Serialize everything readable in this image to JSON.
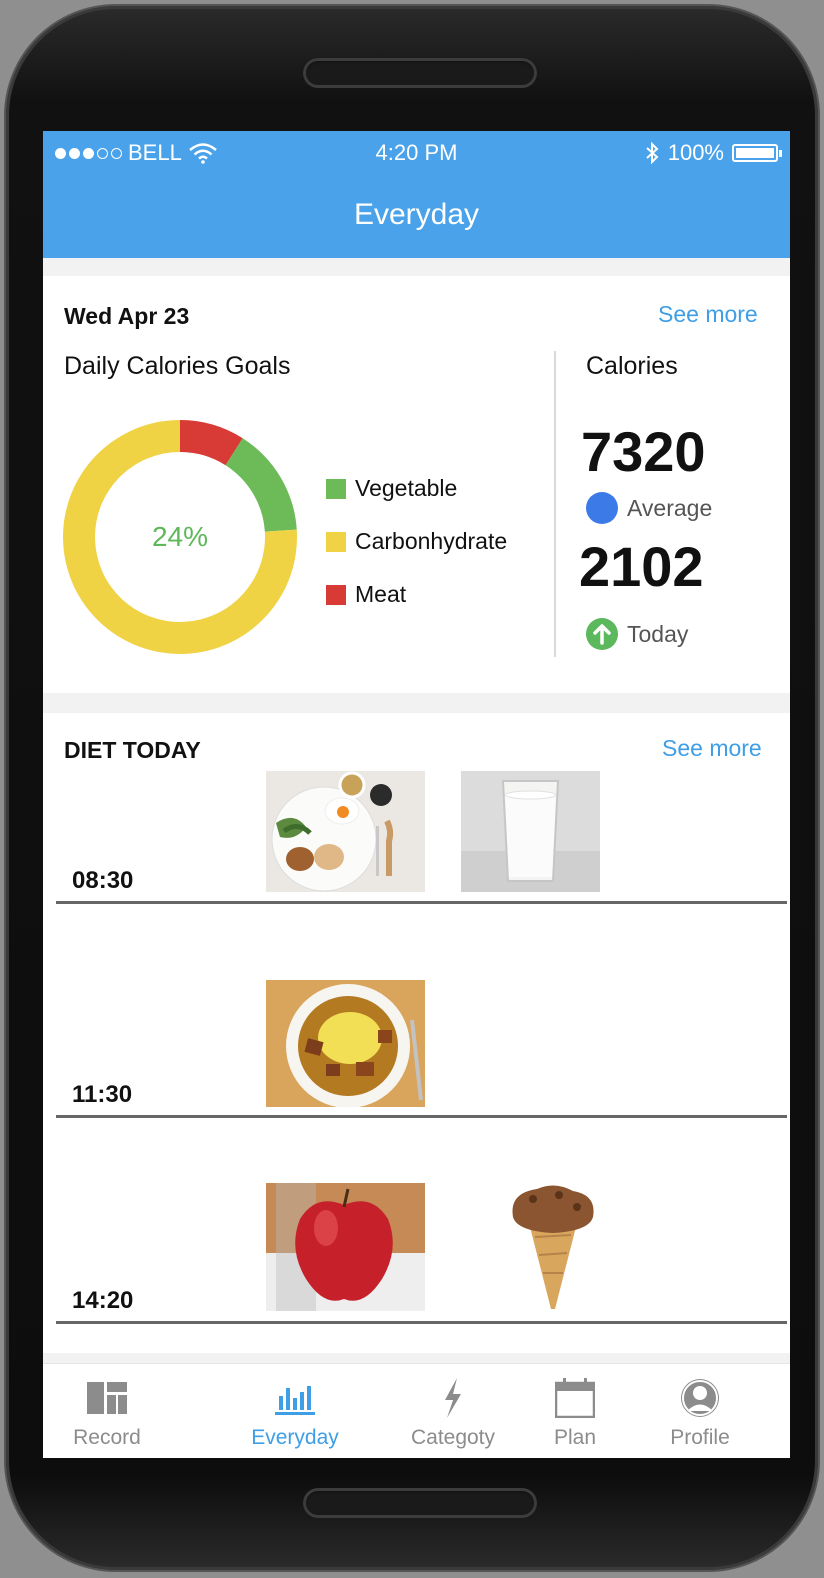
{
  "status_bar": {
    "carrier": "BELL",
    "time": "4:20 PM",
    "battery": "100%",
    "battery_level": 1.0
  },
  "nav": {
    "title": "Everyday"
  },
  "summary": {
    "date": "Wed Apr 23",
    "see_more": "See more",
    "goals_title": "Daily Calories Goals",
    "donut_center": "24%",
    "donut_segments": [
      {
        "name": "Meat",
        "percent": 9,
        "color": "#d83a36"
      },
      {
        "name": "Vegetable",
        "percent": 15,
        "color": "#6cba58"
      },
      {
        "name": "Carbonhydrate",
        "percent": 76,
        "color": "#f0d245"
      }
    ],
    "legend": [
      {
        "label": "Vegetable",
        "color": "#6cba58"
      },
      {
        "label": "Carbonhydrate",
        "color": "#f0d245"
      },
      {
        "label": "Meat",
        "color": "#d83a36"
      }
    ],
    "calories_title": "Calories",
    "average_value": "7320",
    "average_label": "Average",
    "today_value": "2102",
    "today_label": "Today"
  },
  "diet": {
    "title": "DIET TODAY",
    "see_more": "See more",
    "meals": [
      {
        "time": "08:30",
        "items": [
          "breakfast-plate",
          "glass-of-milk"
        ]
      },
      {
        "time": "11:30",
        "items": [
          "curry-omelette-rice"
        ]
      },
      {
        "time": "14:20",
        "items": [
          "red-apple",
          "chocolate-ice-cream-cone"
        ]
      }
    ]
  },
  "tabs": [
    {
      "label": "Record",
      "icon": "dashboard-icon",
      "active": false
    },
    {
      "label": "Everyday",
      "icon": "bar-chart-icon",
      "active": true
    },
    {
      "label": "Categoty",
      "icon": "lightning-icon",
      "active": false
    },
    {
      "label": "Plan",
      "icon": "calendar-icon",
      "active": false
    },
    {
      "label": "Profile",
      "icon": "user-icon",
      "active": false
    }
  ],
  "colors": {
    "brand": "#4aa3ea",
    "link": "#3e9ee6",
    "inactive_tab": "#8c8c8c"
  }
}
